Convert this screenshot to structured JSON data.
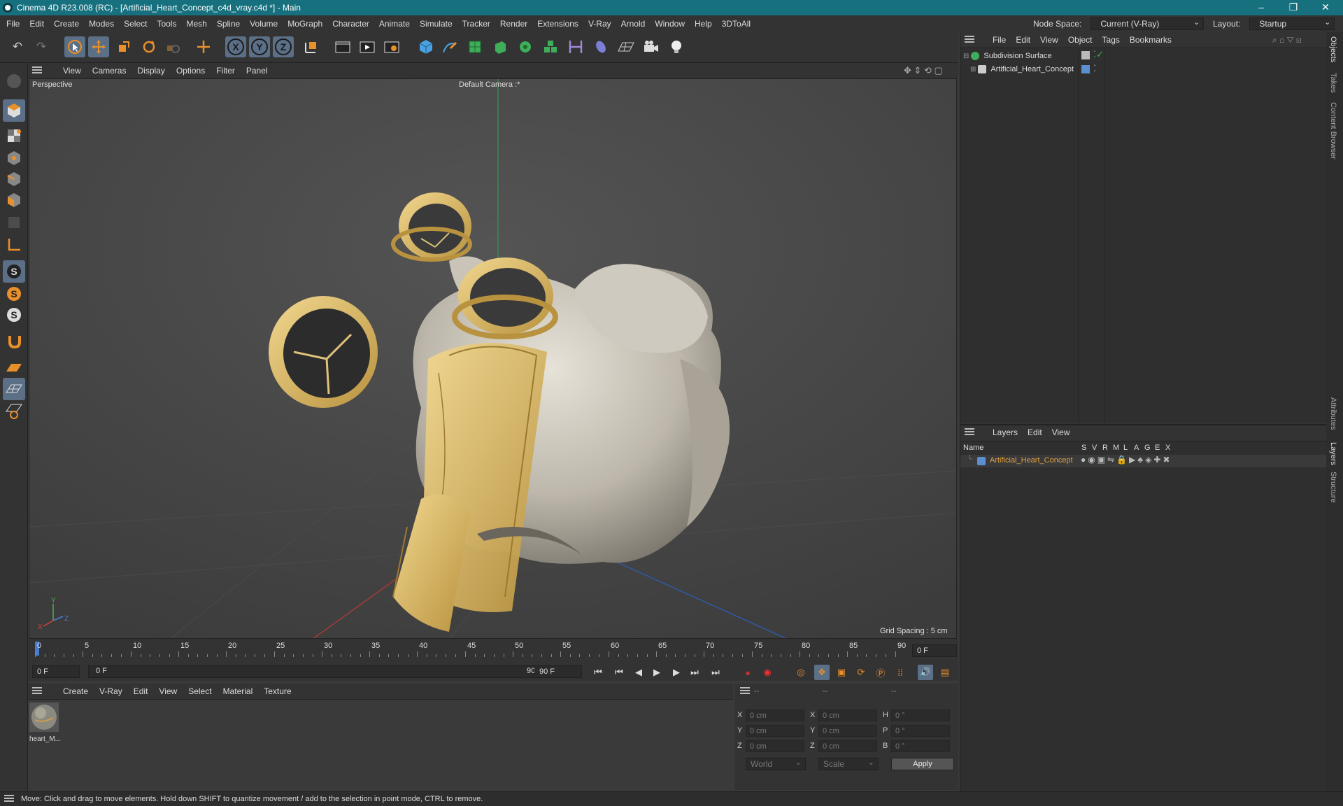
{
  "window": {
    "title": "Cinema 4D R23.008 (RC) - [Artificial_Heart_Concept_c4d_vray.c4d *] - Main",
    "minimize": "–",
    "maximize": "❐",
    "close": "✕"
  },
  "menu": [
    "File",
    "Edit",
    "Create",
    "Modes",
    "Select",
    "Tools",
    "Mesh",
    "Spline",
    "Volume",
    "MoGraph",
    "Character",
    "Animate",
    "Simulate",
    "Tracker",
    "Render",
    "Extensions",
    "V-Ray",
    "Arnold",
    "Window",
    "Help",
    "3DToAll"
  ],
  "nodespace": {
    "label": "Node Space:",
    "value": "Current (V-Ray)"
  },
  "layout": {
    "label": "Layout:",
    "value": "Startup"
  },
  "axis_buttons": [
    "X",
    "Y",
    "Z"
  ],
  "viewport": {
    "menu": [
      "View",
      "Cameras",
      "Display",
      "Options",
      "Filter",
      "Panel"
    ],
    "name": "Perspective",
    "camera": "Default Camera :*",
    "grid_spacing": "Grid Spacing : 5 cm",
    "axis_labels": {
      "y": "Y",
      "x": "X",
      "z": "Z"
    }
  },
  "timeline": {
    "ticks": [
      "0",
      "5",
      "10",
      "15",
      "20",
      "25",
      "30",
      "35",
      "40",
      "45",
      "50",
      "55",
      "60",
      "65",
      "70",
      "75",
      "80",
      "85",
      "90"
    ],
    "current_frame": "0 F",
    "start_field": "0 F",
    "range_start": "0 F",
    "range_end": "90 F",
    "end_field": "90 F"
  },
  "material_menu": [
    "Create",
    "V-Ray",
    "Edit",
    "View",
    "Select",
    "Material",
    "Texture"
  ],
  "materials": [
    {
      "name": "heart_M..."
    }
  ],
  "coords": {
    "headers": [
      "--",
      "--",
      "--"
    ],
    "rows": [
      {
        "a": "X",
        "av": "0 cm",
        "b": "X",
        "bv": "0 cm",
        "c": "H",
        "cv": "0 °"
      },
      {
        "a": "Y",
        "av": "0 cm",
        "b": "Y",
        "bv": "0 cm",
        "c": "P",
        "cv": "0 °"
      },
      {
        "a": "Z",
        "av": "0 cm",
        "b": "Z",
        "bv": "0 cm",
        "c": "B",
        "cv": "0 °"
      }
    ],
    "world": "World",
    "scale": "Scale",
    "apply": "Apply"
  },
  "objects_panel": {
    "menu": [
      "File",
      "Edit",
      "View",
      "Object",
      "Tags",
      "Bookmarks"
    ],
    "items": [
      {
        "name": "Subdivision Surface",
        "indent": false
      },
      {
        "name": "Artificial_Heart_Concept",
        "indent": true
      }
    ]
  },
  "layers_panel": {
    "menu": [
      "Layers",
      "Edit",
      "View"
    ],
    "columns": [
      "Name",
      "S",
      "V",
      "R",
      "M",
      "L",
      "A",
      "G",
      "E",
      "X"
    ],
    "rows": [
      {
        "name": "Artificial_Heart_Concept"
      }
    ]
  },
  "side_tabs": [
    "Objects",
    "Takes",
    "Content Browser",
    "Attributes",
    "Layers",
    "Structure"
  ],
  "status": "Move: Click and drag to move elements. Hold down SHIFT to quantize movement / add to the selection in point mode, CTRL to remove.",
  "colors": {
    "title_bar": "#16707e",
    "accent_orange": "#e9902b",
    "selected_blue": "#5b6f86",
    "object_highlight": "#e0a040"
  }
}
